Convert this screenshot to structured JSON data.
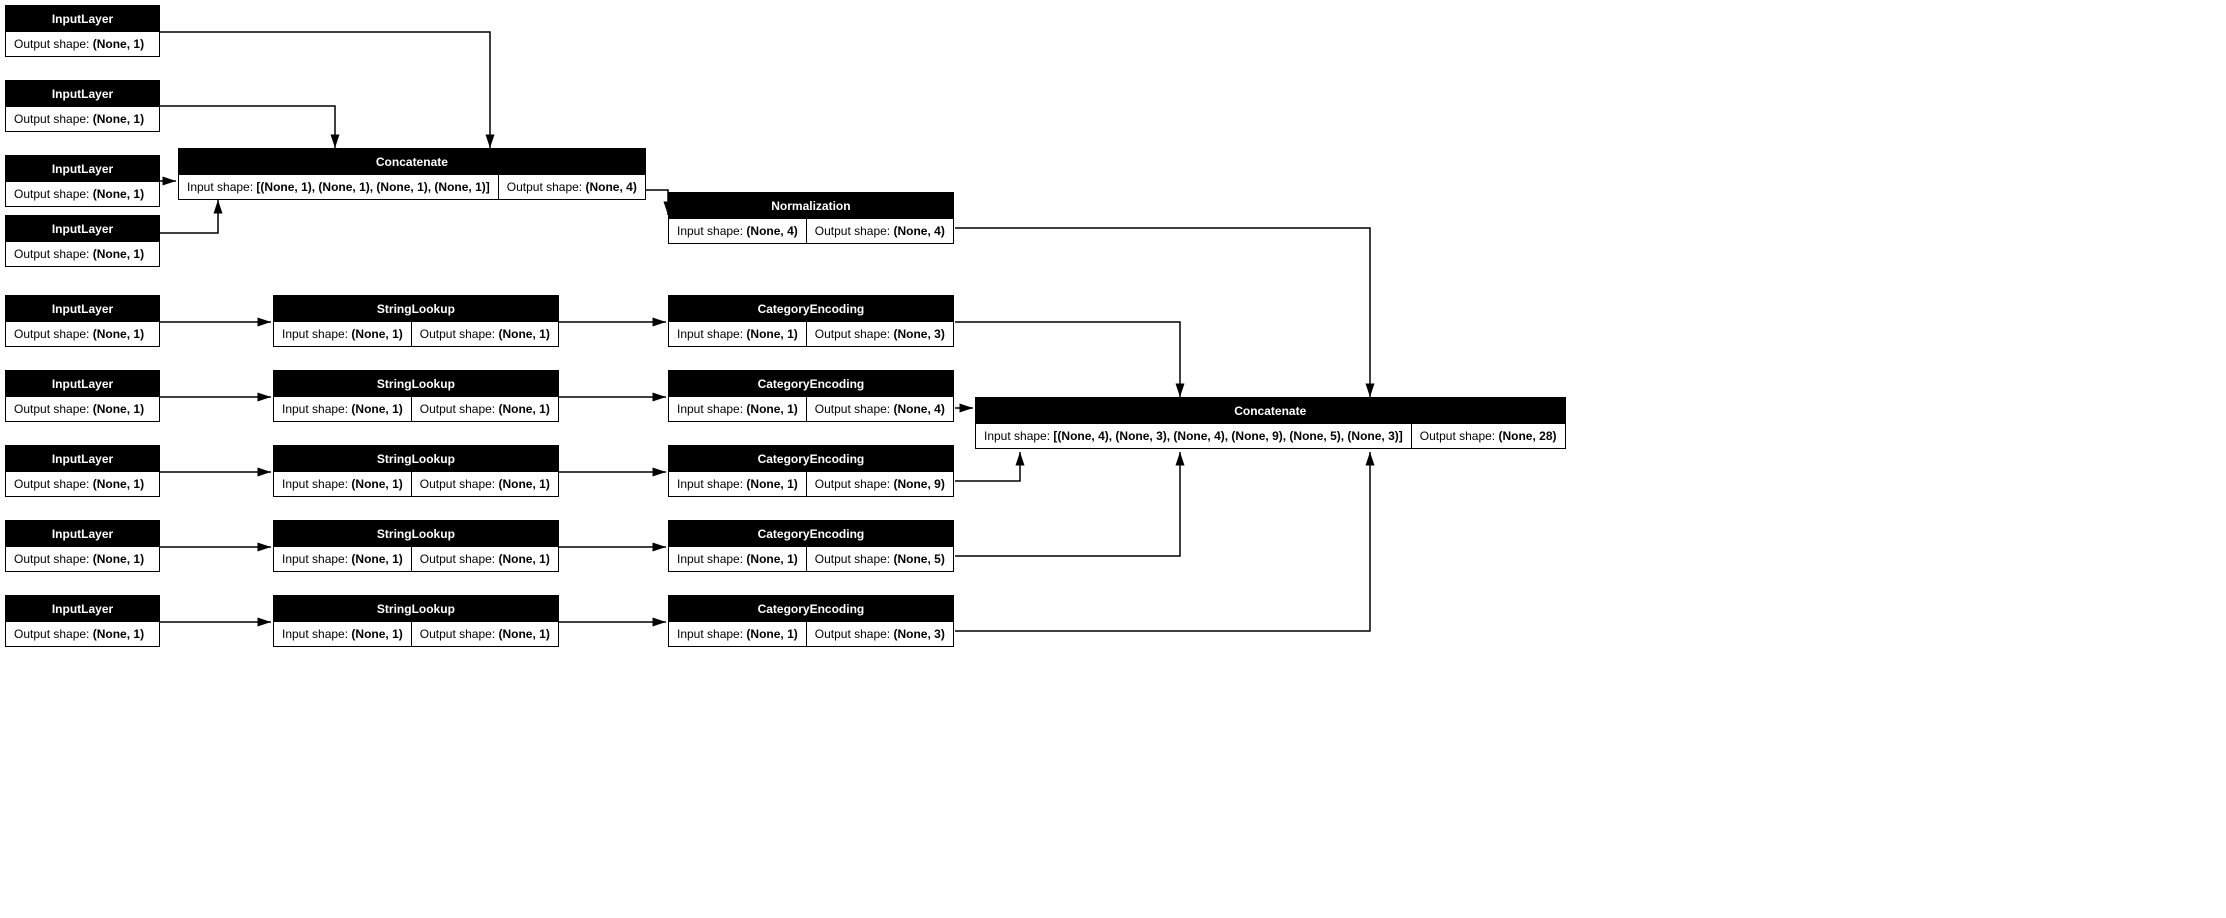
{
  "chart_data": {
    "type": "diagram",
    "title": "Keras model architecture graph",
    "nodes": [
      {
        "id": "in1",
        "layer": "InputLayer",
        "output": "(None, 1)"
      },
      {
        "id": "in2",
        "layer": "InputLayer",
        "output": "(None, 1)"
      },
      {
        "id": "in3",
        "layer": "InputLayer",
        "output": "(None, 1)"
      },
      {
        "id": "in4",
        "layer": "InputLayer",
        "output": "(None, 1)"
      },
      {
        "id": "in5",
        "layer": "InputLayer",
        "output": "(None, 1)"
      },
      {
        "id": "in6",
        "layer": "InputLayer",
        "output": "(None, 1)"
      },
      {
        "id": "in7",
        "layer": "InputLayer",
        "output": "(None, 1)"
      },
      {
        "id": "in8",
        "layer": "InputLayer",
        "output": "(None, 1)"
      },
      {
        "id": "in9",
        "layer": "InputLayer",
        "output": "(None, 1)"
      },
      {
        "id": "concat1",
        "layer": "Concatenate",
        "input": "[(None, 1), (None, 1), (None, 1), (None, 1)]",
        "output": "(None, 4)"
      },
      {
        "id": "norm",
        "layer": "Normalization",
        "input": "(None, 4)",
        "output": "(None, 4)"
      },
      {
        "id": "sl1",
        "layer": "StringLookup",
        "input": "(None, 1)",
        "output": "(None, 1)"
      },
      {
        "id": "sl2",
        "layer": "StringLookup",
        "input": "(None, 1)",
        "output": "(None, 1)"
      },
      {
        "id": "sl3",
        "layer": "StringLookup",
        "input": "(None, 1)",
        "output": "(None, 1)"
      },
      {
        "id": "sl4",
        "layer": "StringLookup",
        "input": "(None, 1)",
        "output": "(None, 1)"
      },
      {
        "id": "sl5",
        "layer": "StringLookup",
        "input": "(None, 1)",
        "output": "(None, 1)"
      },
      {
        "id": "ce1",
        "layer": "CategoryEncoding",
        "input": "(None, 1)",
        "output": "(None, 3)"
      },
      {
        "id": "ce2",
        "layer": "CategoryEncoding",
        "input": "(None, 1)",
        "output": "(None, 4)"
      },
      {
        "id": "ce3",
        "layer": "CategoryEncoding",
        "input": "(None, 1)",
        "output": "(None, 9)"
      },
      {
        "id": "ce4",
        "layer": "CategoryEncoding",
        "input": "(None, 1)",
        "output": "(None, 5)"
      },
      {
        "id": "ce5",
        "layer": "CategoryEncoding",
        "input": "(None, 1)",
        "output": "(None, 3)"
      },
      {
        "id": "concat2",
        "layer": "Concatenate",
        "input": "[(None, 4), (None, 3), (None, 4), (None, 9), (None, 5), (None, 3)]",
        "output": "(None, 28)"
      }
    ],
    "edges": [
      [
        "in1",
        "concat1"
      ],
      [
        "in2",
        "concat1"
      ],
      [
        "in3",
        "concat1"
      ],
      [
        "in4",
        "concat1"
      ],
      [
        "concat1",
        "norm"
      ],
      [
        "in5",
        "sl1"
      ],
      [
        "in6",
        "sl2"
      ],
      [
        "in7",
        "sl3"
      ],
      [
        "in8",
        "sl4"
      ],
      [
        "in9",
        "sl5"
      ],
      [
        "sl1",
        "ce1"
      ],
      [
        "sl2",
        "ce2"
      ],
      [
        "sl3",
        "ce3"
      ],
      [
        "sl4",
        "ce4"
      ],
      [
        "sl5",
        "ce5"
      ],
      [
        "norm",
        "concat2"
      ],
      [
        "ce1",
        "concat2"
      ],
      [
        "ce2",
        "concat2"
      ],
      [
        "ce3",
        "concat2"
      ],
      [
        "ce4",
        "concat2"
      ],
      [
        "ce5",
        "concat2"
      ]
    ]
  },
  "labels": {
    "input_shape": "Input shape:",
    "output_shape": "Output shape:"
  },
  "nodes": {
    "in1": {
      "name": "InputLayer",
      "out": "(None, 1)"
    },
    "in2": {
      "name": "InputLayer",
      "out": "(None, 1)"
    },
    "in3": {
      "name": "InputLayer",
      "out": "(None, 1)"
    },
    "in4": {
      "name": "InputLayer",
      "out": "(None, 1)"
    },
    "in5": {
      "name": "InputLayer",
      "out": "(None, 1)"
    },
    "in6": {
      "name": "InputLayer",
      "out": "(None, 1)"
    },
    "in7": {
      "name": "InputLayer",
      "out": "(None, 1)"
    },
    "in8": {
      "name": "InputLayer",
      "out": "(None, 1)"
    },
    "in9": {
      "name": "InputLayer",
      "out": "(None, 1)"
    },
    "concat1": {
      "name": "Concatenate",
      "in": "[(None, 1), (None, 1), (None, 1), (None, 1)]",
      "out": "(None, 4)"
    },
    "norm": {
      "name": "Normalization",
      "in": "(None, 4)",
      "out": "(None, 4)"
    },
    "sl1": {
      "name": "StringLookup",
      "in": "(None, 1)",
      "out": "(None, 1)"
    },
    "sl2": {
      "name": "StringLookup",
      "in": "(None, 1)",
      "out": "(None, 1)"
    },
    "sl3": {
      "name": "StringLookup",
      "in": "(None, 1)",
      "out": "(None, 1)"
    },
    "sl4": {
      "name": "StringLookup",
      "in": "(None, 1)",
      "out": "(None, 1)"
    },
    "sl5": {
      "name": "StringLookup",
      "in": "(None, 1)",
      "out": "(None, 1)"
    },
    "ce1": {
      "name": "CategoryEncoding",
      "in": "(None, 1)",
      "out": "(None, 3)"
    },
    "ce2": {
      "name": "CategoryEncoding",
      "in": "(None, 1)",
      "out": "(None, 4)"
    },
    "ce3": {
      "name": "CategoryEncoding",
      "in": "(None, 1)",
      "out": "(None, 9)"
    },
    "ce4": {
      "name": "CategoryEncoding",
      "in": "(None, 1)",
      "out": "(None, 5)"
    },
    "ce5": {
      "name": "CategoryEncoding",
      "in": "(None, 1)",
      "out": "(None, 3)"
    },
    "concat2": {
      "name": "Concatenate",
      "in": "[(None, 4), (None, 3), (None, 4), (None, 9), (None, 5), (None, 3)]",
      "out": "(None, 28)"
    }
  }
}
